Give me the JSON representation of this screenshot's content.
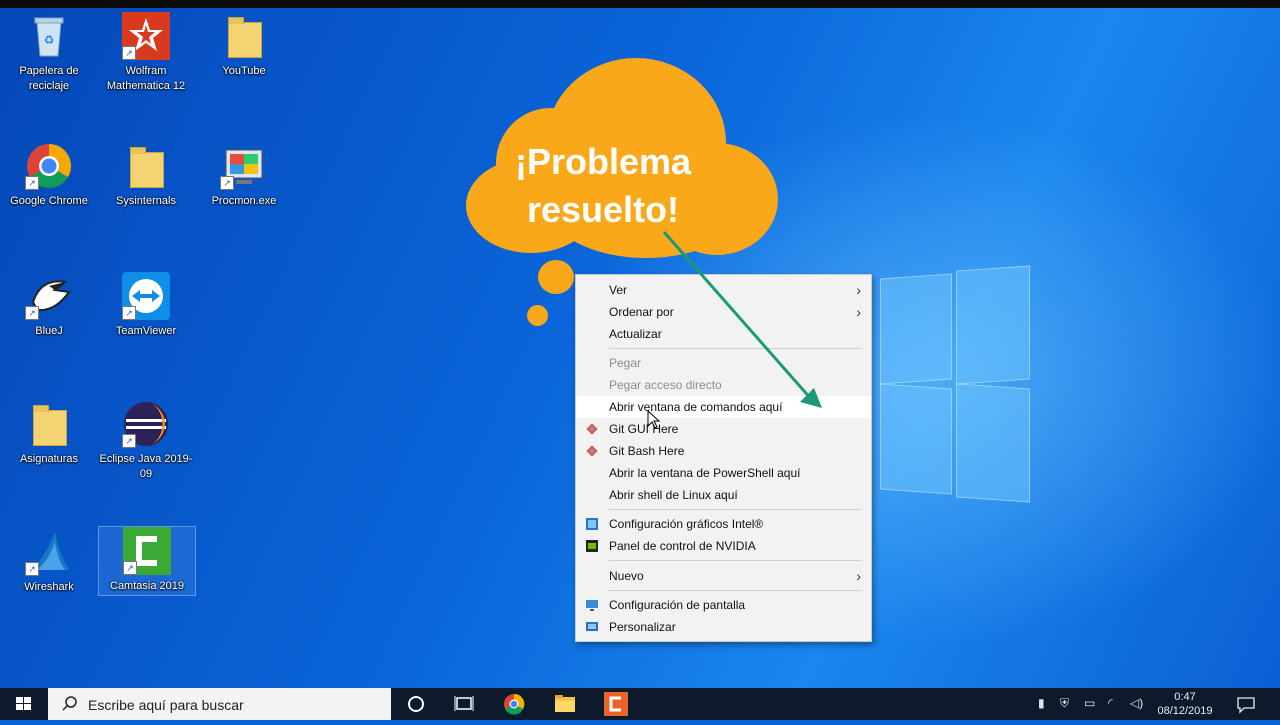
{
  "desktop": {
    "icons": [
      {
        "label": "Papelera de reciclaje"
      },
      {
        "label": "Wolfram Mathematica 12"
      },
      {
        "label": "YouTube"
      },
      {
        "label": "Google Chrome"
      },
      {
        "label": "Sysinternals"
      },
      {
        "label": "Procmon.exe"
      },
      {
        "label": "BlueJ"
      },
      {
        "label": "TeamViewer"
      },
      {
        "label": "Asignaturas"
      },
      {
        "label": "Eclipse Java 2019-09"
      },
      {
        "label": "Wireshark"
      },
      {
        "label": "Camtasia 2019"
      }
    ]
  },
  "callout": {
    "line1": "¡Problema",
    "line2": "resuelto!"
  },
  "context_menu": {
    "items": [
      {
        "label": "Ver",
        "submenu": true
      },
      {
        "label": "Ordenar por",
        "submenu": true
      },
      {
        "label": "Actualizar"
      },
      {
        "label": "Pegar",
        "disabled": true
      },
      {
        "label": "Pegar acceso directo",
        "disabled": true
      },
      {
        "label": "Abrir ventana de comandos aquí",
        "highlighted": true
      },
      {
        "label": "Git GUI Here"
      },
      {
        "label": "Git Bash Here"
      },
      {
        "label": "Abrir la ventana de PowerShell aquí"
      },
      {
        "label": "Abrir shell de Linux aquí"
      },
      {
        "label": "Configuración gráficos Intel®"
      },
      {
        "label": "Panel de control de NVIDIA"
      },
      {
        "label": "Nuevo",
        "submenu": true
      },
      {
        "label": "Configuración de pantalla"
      },
      {
        "label": "Personalizar"
      }
    ]
  },
  "taskbar": {
    "search_placeholder": "Escribe aquí para buscar",
    "time": "0:47",
    "date": "08/12/2019"
  },
  "colors": {
    "callout": "#f9a81a",
    "arrow": "#1a9a7a",
    "desktop": "#0a63d8",
    "taskbar": "#0d1a2b"
  }
}
